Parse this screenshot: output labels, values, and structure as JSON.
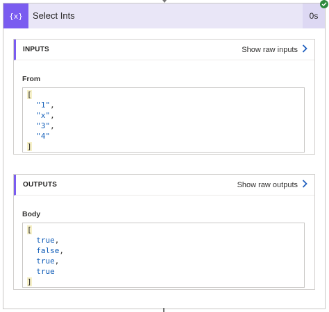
{
  "action": {
    "title": "Select Ints",
    "duration": "0s",
    "icon": "curly-braces-variable-icon",
    "status": "succeeded",
    "colors": {
      "accent": "#7a5cf0",
      "header_bg": "#e9e6f7",
      "duration_bg": "#ddd8f3",
      "success": "#2e8a3d",
      "code_value": "#0f5cb8"
    }
  },
  "inputs": {
    "heading": "INPUTS",
    "show_raw_label": "Show raw inputs",
    "field_label": "From",
    "open_bracket": "[",
    "close_bracket": "]",
    "items": [
      {
        "value": "\"1\"",
        "sep": ","
      },
      {
        "value": "\"x\"",
        "sep": ","
      },
      {
        "value": "\"3\"",
        "sep": ","
      },
      {
        "value": "\"4\"",
        "sep": ""
      }
    ]
  },
  "outputs": {
    "heading": "OUTPUTS",
    "show_raw_label": "Show raw outputs",
    "field_label": "Body",
    "open_bracket": "[",
    "close_bracket": "]",
    "items": [
      {
        "value": "true",
        "sep": ","
      },
      {
        "value": "false",
        "sep": ","
      },
      {
        "value": "true",
        "sep": ","
      },
      {
        "value": "true",
        "sep": ""
      }
    ]
  }
}
